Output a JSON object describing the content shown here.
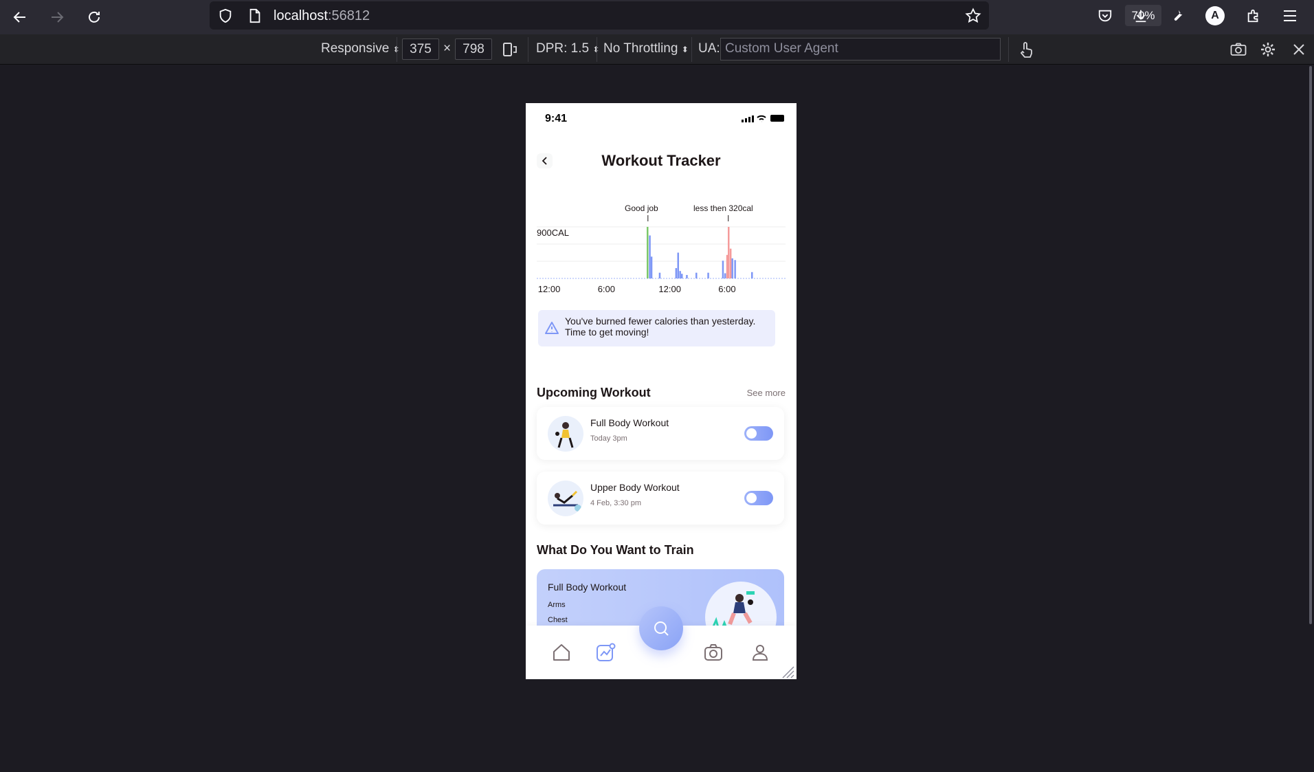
{
  "browser": {
    "url_host": "localhost",
    "url_port": ":56812",
    "zoom": "70%",
    "profile_initial": "A"
  },
  "rdm": {
    "device": "Responsive",
    "width": "375",
    "times": "×",
    "height": "798",
    "dpr": "DPR: 1.5",
    "throttling": "No Throttling",
    "ua_label": "UA:",
    "ua_placeholder": "Custom User Agent"
  },
  "status_bar": {
    "time": "9:41"
  },
  "page": {
    "title": "Workout Tracker",
    "alert_text": "You've burned fewer calories than yesterday. Time to get moving!",
    "upcoming_title": "Upcoming Workout",
    "see_more": "See more",
    "train_title": "What Do You Want to Train"
  },
  "workouts": [
    {
      "name": "Full Body Workout",
      "time": "Today 3pm",
      "enabled": false
    },
    {
      "name": "Upper Body Workout",
      "time": "4 Feb, 3:30 pm",
      "enabled": false
    }
  ],
  "train_card": {
    "title": "Full Body Workout",
    "items": [
      "Arms",
      "Chest"
    ]
  },
  "chart_data": {
    "type": "bar",
    "ylabel": "900CAL",
    "x_ticks": [
      "12:00",
      "6:00",
      "12:00",
      "6:00"
    ],
    "annotations": [
      "Good job",
      "less then 320cal"
    ],
    "series": [
      {
        "values": [
          0,
          0,
          0,
          0,
          0,
          0,
          0,
          0,
          0,
          0,
          0,
          0,
          0,
          0,
          0,
          0,
          0,
          0,
          0,
          0,
          0,
          0,
          0,
          0,
          0,
          0,
          0,
          0,
          0,
          0,
          0,
          0,
          0,
          0,
          0,
          0,
          0,
          0,
          0,
          0,
          0,
          0,
          0,
          0,
          0,
          0,
          0,
          0,
          0,
          0,
          0,
          0,
          0,
          0,
          0,
          0,
          0,
          0,
          0,
          0,
          0,
          0,
          0,
          0,
          0,
          0,
          0,
          0,
          0,
          0,
          0,
          0,
          0,
          0,
          0,
          0,
          0,
          0,
          0,
          0,
          0,
          0,
          0,
          0,
          0,
          0,
          0,
          0,
          0,
          0,
          0,
          0,
          0,
          0,
          0,
          0,
          0,
          0,
          0,
          0,
          0,
          0,
          0,
          0,
          0,
          0,
          0,
          0,
          0,
          0,
          0,
          0,
          0,
          0,
          0,
          0,
          0,
          0,
          0,
          0,
          0,
          0,
          0,
          0,
          0,
          0,
          0,
          0,
          0,
          0,
          0,
          0,
          0,
          0,
          0,
          0,
          0,
          0,
          0,
          0,
          0,
          0,
          0,
          0,
          0,
          0,
          0,
          0,
          0
        ]
      }
    ],
    "bars": [
      {
        "x": 0.442,
        "value": 900,
        "color": "#7cc86a"
      },
      {
        "x": 0.451,
        "value": 750,
        "color": "#7e97f6"
      },
      {
        "x": 0.458,
        "value": 380,
        "color": "#7e97f6"
      },
      {
        "x": 0.491,
        "value": 100,
        "color": "#7e97f6"
      },
      {
        "x": 0.557,
        "value": 180,
        "color": "#7e97f6"
      },
      {
        "x": 0.565,
        "value": 450,
        "color": "#7e97f6"
      },
      {
        "x": 0.573,
        "value": 130,
        "color": "#7e97f6"
      },
      {
        "x": 0.58,
        "value": 80,
        "color": "#7e97f6"
      },
      {
        "x": 0.6,
        "value": 60,
        "color": "#7e97f6"
      },
      {
        "x": 0.638,
        "value": 100,
        "color": "#7e97f6"
      },
      {
        "x": 0.686,
        "value": 100,
        "color": "#7e97f6"
      },
      {
        "x": 0.745,
        "value": 310,
        "color": "#7e97f6"
      },
      {
        "x": 0.754,
        "value": 90,
        "color": "#7e97f6"
      },
      {
        "x": 0.762,
        "value": 410,
        "color": "#f59b9b"
      },
      {
        "x": 0.768,
        "value": 900,
        "color": "#f59b9b"
      },
      {
        "x": 0.776,
        "value": 520,
        "color": "#f59b9b"
      },
      {
        "x": 0.783,
        "value": 350,
        "color": "#7e97f6"
      },
      {
        "x": 0.794,
        "value": 320,
        "color": "#7e97f6"
      },
      {
        "x": 0.862,
        "value": 110,
        "color": "#7e97f6"
      }
    ]
  },
  "colors": {
    "accent": "#7e97f6",
    "good": "#7cc86a",
    "warn": "#f59b9b",
    "text": "#1d1617",
    "muted": "#7b6f72"
  }
}
